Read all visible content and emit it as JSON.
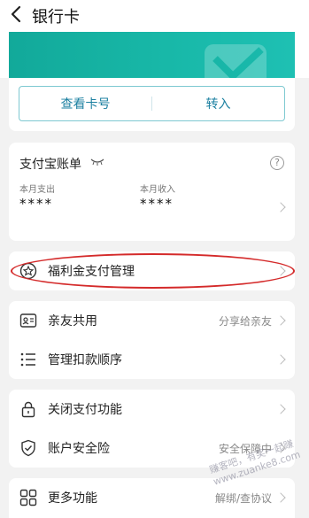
{
  "header": {
    "title": "银行卡"
  },
  "card": {
    "view_card_number": "查看卡号",
    "transfer_in": "转入",
    "accent": "#12a99a"
  },
  "bill": {
    "title": "支付宝账单",
    "month_expense_label": "本月支出",
    "month_expense_value": "****",
    "month_income_label": "本月收入",
    "month_income_value": "****"
  },
  "welfare": {
    "label": "福利金支付管理"
  },
  "family": [
    {
      "label": "亲友共用",
      "sub": "分享给亲友",
      "icon": "people-card-icon"
    },
    {
      "label": "管理扣款顺序",
      "sub": "",
      "icon": "list-icon"
    }
  ],
  "security": [
    {
      "label": "关闭支付功能",
      "sub": "",
      "icon": "lock-icon"
    },
    {
      "label": "账户安全险",
      "sub": "安全保障中",
      "icon": "shield-check-icon"
    }
  ],
  "more": {
    "label": "更多功能",
    "sub": "解绑/查协议"
  },
  "watermark": "赚客吧，有奖一起赚 www.zuanke8.com"
}
